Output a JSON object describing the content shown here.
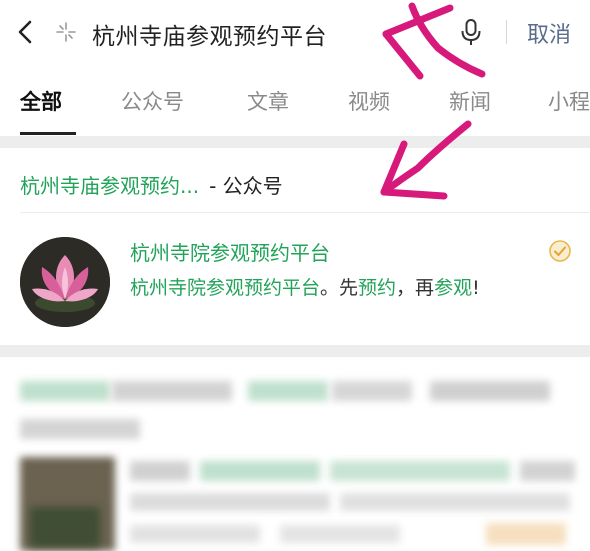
{
  "search": {
    "query": "杭州寺庙参观预约平台",
    "cancel_label": "取消"
  },
  "tabs": [
    {
      "label": "全部",
      "active": true
    },
    {
      "label": "公众号",
      "active": false
    },
    {
      "label": "文章",
      "active": false
    },
    {
      "label": "视频",
      "active": false
    },
    {
      "label": "新闻",
      "active": false
    },
    {
      "label": "小程",
      "active": false
    }
  ],
  "section": {
    "title_highlight": "杭州寺庙参观预约...",
    "title_suffix": "- 公众号"
  },
  "account": {
    "name": "杭州寺院参观预约平台",
    "desc_highlight_1": "杭州寺院参观预约平台",
    "desc_plain_1": "。先",
    "desc_highlight_2": "预约",
    "desc_plain_2": "，再",
    "desc_highlight_3": "参观",
    "desc_plain_3": "!"
  },
  "colors": {
    "highlight": "#22a35a",
    "cancel": "#5b6b8c",
    "annotation": "#d6197a",
    "verified": "#e8b84a"
  },
  "icons": {
    "back": "chevron-left-icon",
    "sparkle": "sparkle-icon",
    "mic": "microphone-icon",
    "verified": "verified-badge-icon"
  }
}
